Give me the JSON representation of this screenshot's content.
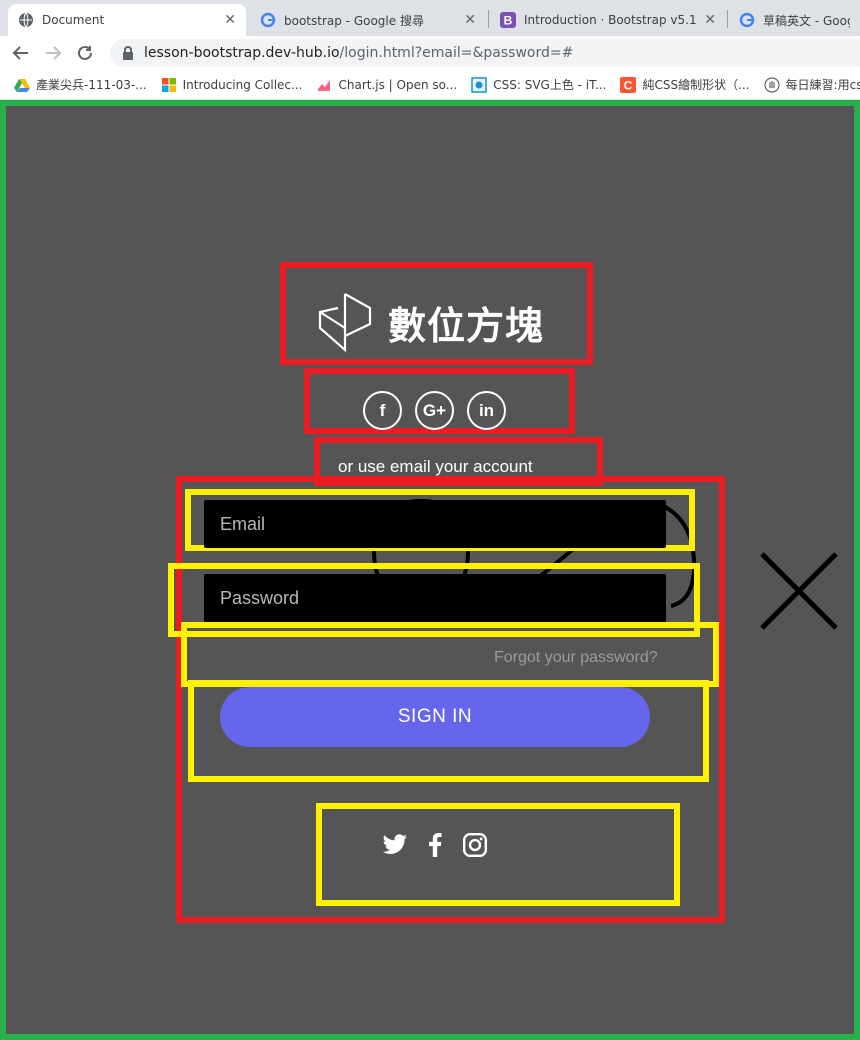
{
  "browser": {
    "tabs": [
      {
        "title": "Document",
        "active": true,
        "favicon": "globe-icon"
      },
      {
        "title": "bootstrap - Google 搜尋",
        "active": false,
        "favicon": "google-icon"
      },
      {
        "title": "Introduction · Bootstrap v5.1",
        "active": false,
        "favicon": "bootstrap-icon"
      },
      {
        "title": "草稿英文 - Google",
        "active": false,
        "favicon": "google-icon"
      }
    ],
    "url_host": "lesson-bootstrap.dev-hub.io",
    "url_path": "/login.html?email=&password=#",
    "bookmarks": [
      {
        "label": "產業尖兵-111-03-...",
        "icon": "drive-icon"
      },
      {
        "label": "Introducing Collec...",
        "icon": "microsoft-icon"
      },
      {
        "label": "Chart.js | Open so...",
        "icon": "chartjs-icon"
      },
      {
        "label": "CSS: SVG上色 - iT...",
        "icon": "ithome-icon"
      },
      {
        "label": "純CSS繪制形状（...",
        "icon": "c-icon"
      },
      {
        "label": "每日練習:用css實",
        "icon": "hand-icon"
      }
    ]
  },
  "page": {
    "brand_name": "數位方塊",
    "social_buttons": [
      "f",
      "G+",
      "in"
    ],
    "or_text": "or use email your account",
    "email_placeholder": "Email",
    "password_placeholder": "Password",
    "forgot_text": "Forgot your password?",
    "signin_label": "SIGN IN",
    "footer_icons": [
      "twitter-icon",
      "facebook-icon",
      "instagram-icon"
    ]
  },
  "colors": {
    "page_bg": "#555555",
    "outline_red": "#ed1c24",
    "outline_yellow": "#fff200",
    "outline_green": "#28b04a",
    "signin_button": "#6566ec"
  }
}
